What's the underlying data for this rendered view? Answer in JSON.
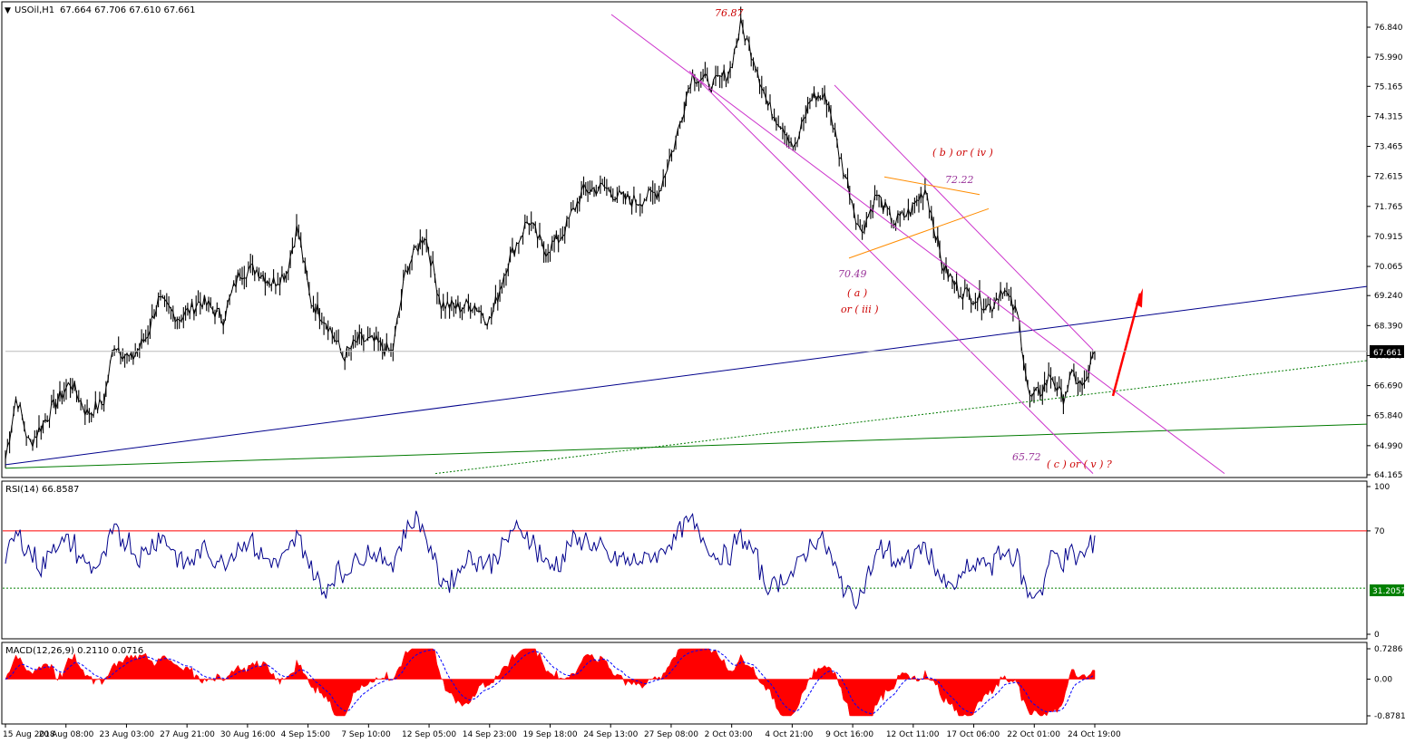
{
  "header": {
    "symbol_label": "USOil,H1",
    "ohlc_label": "67.664 67.706 67.610 67.661"
  },
  "panes": {
    "rsi_label": "RSI(14) 66.8587",
    "macd_label": "MACD(12,26,9) 0.2110 0.0716"
  },
  "price_axis": {
    "ticks": [
      "76.840",
      "75.990",
      "75.165",
      "74.315",
      "73.465",
      "72.615",
      "71.765",
      "70.915",
      "70.065",
      "69.240",
      "68.390",
      "67.540",
      "66.690",
      "65.840",
      "64.990",
      "64.165"
    ],
    "current_price_label": "67.661"
  },
  "rsi_axis": {
    "ticks": [
      "100",
      "70",
      "0"
    ],
    "level_label": "31.2057",
    "upper_level": 70,
    "lower_level": 31.2057
  },
  "macd_axis": {
    "ticks": [
      "0.7286",
      "0.00",
      "-0.8781"
    ]
  },
  "time_axis": {
    "labels": [
      "15 Aug 2018",
      "20 Aug 08:00",
      "23 Aug 03:00",
      "27 Aug 21:00",
      "30 Aug 16:00",
      "4 Sep 15:00",
      "7 Sep 10:00",
      "12 Sep 05:00",
      "14 Sep 23:00",
      "19 Sep 18:00",
      "24 Sep 13:00",
      "27 Sep 08:00",
      "2 Oct 03:00",
      "4 Oct 21:00",
      "9 Oct 16:00",
      "12 Oct 11:00",
      "17 Oct 06:00",
      "22 Oct 01:00",
      "24 Oct 19:00"
    ]
  },
  "annotations": {
    "high": "76.87",
    "b_label": "( b )    or ( iv )",
    "triangle_high": "72.22",
    "low_a": "70.49",
    "a_label": "( a )",
    "a_alt": "or ( iii )",
    "low_c": "65.72",
    "c_label": "( c )  or ( v )  ?"
  },
  "colors": {
    "candles": "#000000",
    "channel": "#cc33cc",
    "blue_trendline": "#00008b",
    "green_trendline": "#007a00",
    "triangle": "#ff8c00",
    "arrow": "#ff0000",
    "annotation_red": "#cc0000",
    "annotation_purple": "#993399",
    "rsi_line": "#00008b",
    "rsi_upper": "#ff0000",
    "rsi_lower": "#008000",
    "macd_hist": "#ff0000",
    "macd_signal": "#0000ff",
    "price_box": "#000000"
  },
  "chart_data": {
    "type": "line",
    "title": "USOil,H1",
    "series": [
      {
        "name": "USOil,H1",
        "x": [
          "15 Aug 2018",
          "20 Aug 08:00",
          "23 Aug 03:00",
          "27 Aug 21:00",
          "30 Aug 16:00",
          "4 Sep 15:00",
          "7 Sep 10:00",
          "12 Sep 05:00",
          "14 Sep 23:00",
          "19 Sep 18:00",
          "24 Sep 13:00",
          "27 Sep 08:00",
          "2 Oct 03:00",
          "4 Oct 21:00",
          "9 Oct 16:00",
          "12 Oct 11:00",
          "17 Oct 06:00",
          "22 Oct 01:00",
          "24 Oct 19:00"
        ],
        "values": [
          64.6,
          65.7,
          68.0,
          68.9,
          69.8,
          69.8,
          67.6,
          69.3,
          68.9,
          70.5,
          72.2,
          72.0,
          75.6,
          74.3,
          74.8,
          71.4,
          68.8,
          66.2,
          67.661
        ]
      }
    ],
    "ylim": [
      64.165,
      77.4
    ],
    "indicators": {
      "rsi_period": 14,
      "rsi_last": 66.8587,
      "rsi_levels": [
        70,
        31.2057
      ],
      "macd": {
        "fast": 12,
        "slow": 26,
        "signal": 9,
        "main": 0.211,
        "signal_value": 0.0716,
        "ylim": [
          -0.8781,
          0.7286
        ]
      }
    }
  }
}
